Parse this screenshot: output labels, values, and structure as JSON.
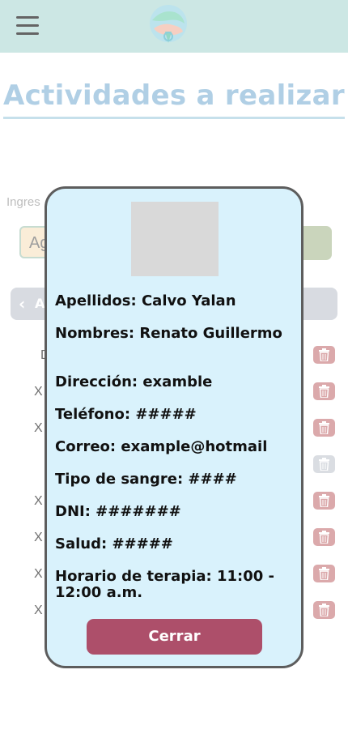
{
  "header": {
    "menu_icon": "hamburger-menu-icon",
    "logo_icon": "hands-globe-logo"
  },
  "page": {
    "title": "Actividades a realizar"
  },
  "form": {
    "hint_text": "Ingres",
    "input_value": "Ag",
    "back_label": "A"
  },
  "list": {
    "rows": [
      "D",
      "X",
      "X",
      "X",
      "X",
      "X",
      "X"
    ],
    "trash_icon": "trash-icon"
  },
  "modal": {
    "apellidos": "Apellidos: Calvo Yalan",
    "nombres": "Nombres: Renato Guillermo",
    "direccion": "Dirección: examble",
    "telefono": "Teléfono: #####",
    "correo": "Correo: example@hotmail",
    "tipo_sangre": "Tipo de sangre: ####",
    "dni": "DNI: #######",
    "salud": "Salud: #####",
    "horario": "Horario de terapia: 11:00 - 12:00 a.m.",
    "close_label": "Cerrar"
  },
  "colors": {
    "header_bg": "#b1dad6",
    "title": "#86b6d8",
    "modal_bg": "#d9f2fc",
    "close_button": "#ad4f6a",
    "trash": "#c87b7e"
  }
}
